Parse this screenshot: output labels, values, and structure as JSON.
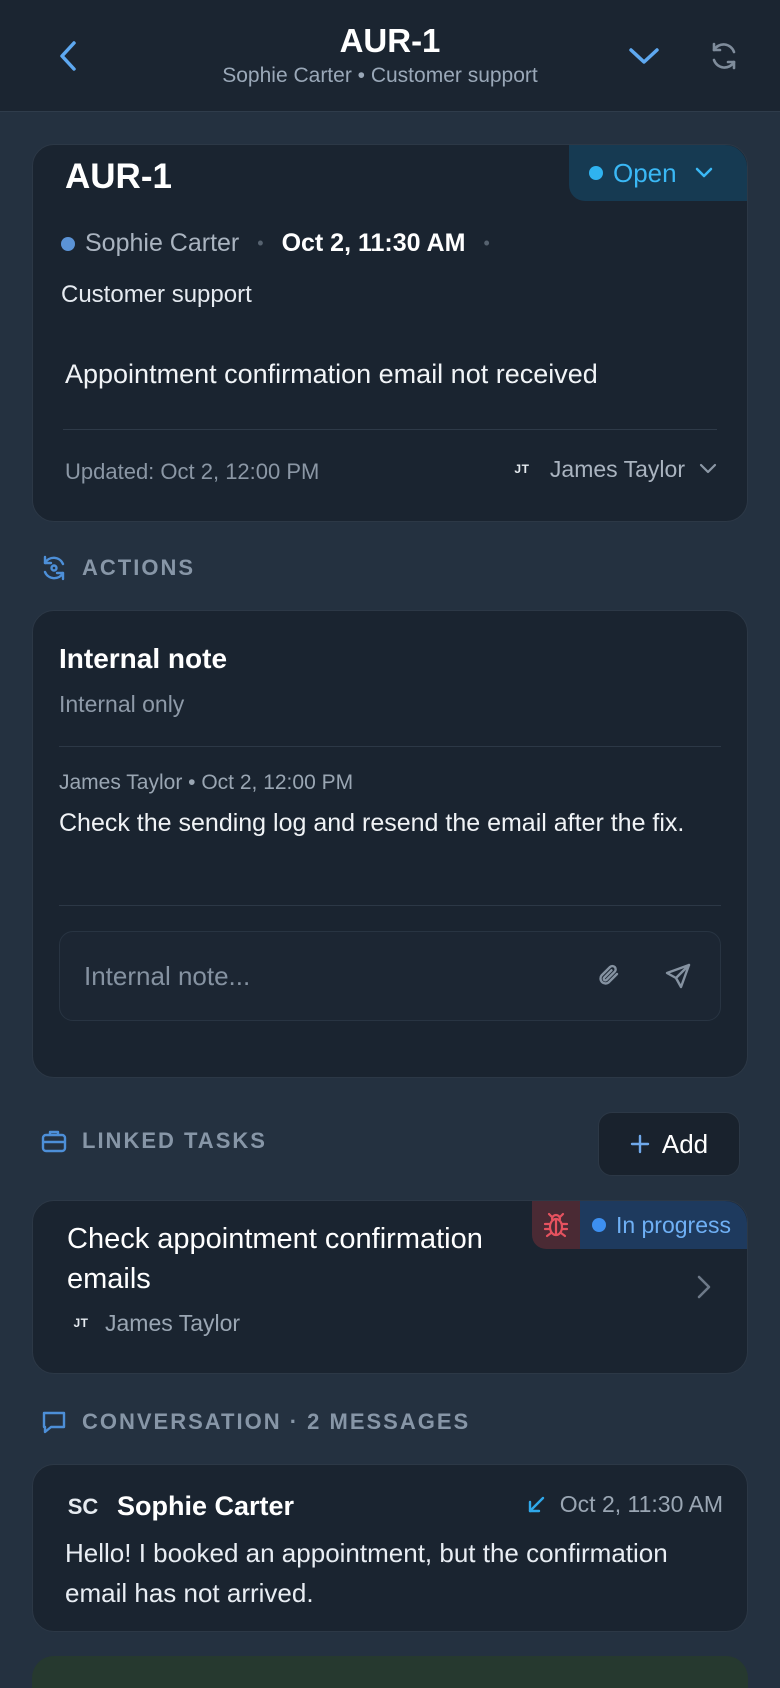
{
  "header": {
    "title": "AUR-1",
    "subtitle": "Sophie Carter • Customer support"
  },
  "ticket": {
    "id": "AUR-1",
    "status": "Open",
    "requester": "Sophie Carter",
    "date": "Oct 2, 11:30 AM",
    "category": "Customer support",
    "subject": "Appointment confirmation email not received",
    "updated": "Updated: Oct 2, 12:00 PM",
    "assignee_initials": "JT",
    "assignee": "James Taylor"
  },
  "actions": {
    "heading": "ACTIONS",
    "note": {
      "title": "Internal note",
      "subtitle": "Internal only",
      "meta": "James Taylor • Oct 2, 12:00 PM",
      "body": "Check the sending log and resend the email after the fix.",
      "placeholder": "Internal note..."
    }
  },
  "linked_tasks": {
    "heading": "LINKED TASKS",
    "add_label": "Add",
    "items": [
      {
        "title": "Check appointment confirmation emails",
        "assignee_initials": "JT",
        "assignee": "James Taylor",
        "status": "In progress"
      }
    ]
  },
  "conversation": {
    "heading": "CONVERSATION · 2 MESSAGES",
    "messages": [
      {
        "initials": "SC",
        "sender": "Sophie Carter",
        "time": "Oct 2, 11:30 AM",
        "body": "Hello! I booked an appointment, but the confirmation email has not arrived."
      }
    ]
  },
  "icons": {
    "back": "chevron-left-icon",
    "expand": "chevron-down-icon",
    "refresh": "refresh-icon",
    "actions": "sync-icon",
    "attach": "paperclip-icon",
    "send": "send-icon",
    "linked": "briefcase-icon",
    "bug": "bug-icon",
    "conversation": "chat-icon",
    "incoming": "arrow-down-left-icon"
  },
  "colors": {
    "accent": "#3ab8f5",
    "background": "#243140",
    "card": "#1a2430",
    "bug": "#e5525f",
    "in_progress": "#6fb0f5"
  }
}
